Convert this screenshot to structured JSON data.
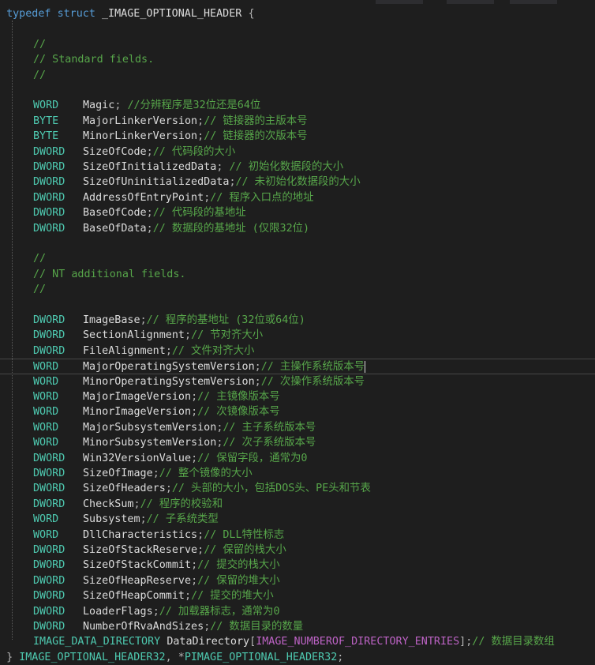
{
  "code": {
    "header_line": {
      "keyword1": "typedef",
      "keyword2": "struct",
      "name": "_IMAGE_OPTIONAL_HEADER",
      "brace": "{"
    },
    "comment_block_1": [
      "//",
      "// Standard fields.",
      "//"
    ],
    "standard_fields": [
      {
        "type": "WORD",
        "name": "Magic",
        "comment": "//分辨程序是32位还是64位",
        "sep": "; "
      },
      {
        "type": "BYTE",
        "name": "MajorLinkerVersion",
        "comment": "// 链接器的主版本号",
        "sep": ";"
      },
      {
        "type": "BYTE",
        "name": "MinorLinkerVersion",
        "comment": "// 链接器的次版本号",
        "sep": ";"
      },
      {
        "type": "DWORD",
        "name": "SizeOfCode",
        "comment": "// 代码段的大小",
        "sep": ";"
      },
      {
        "type": "DWORD",
        "name": "SizeOfInitializedData",
        "comment": "// 初始化数据段的大小",
        "sep": "; "
      },
      {
        "type": "DWORD",
        "name": "SizeOfUninitializedData",
        "comment": "// 未初始化数据段的大小",
        "sep": ";"
      },
      {
        "type": "DWORD",
        "name": "AddressOfEntryPoint",
        "comment": "// 程序入口点的地址",
        "sep": ";"
      },
      {
        "type": "DWORD",
        "name": "BaseOfCode",
        "comment": "// 代码段的基地址",
        "sep": ";"
      },
      {
        "type": "DWORD",
        "name": "BaseOfData",
        "comment": "// 数据段的基地址 (仅限32位)",
        "sep": ";"
      }
    ],
    "comment_block_2": [
      "//",
      "// NT additional fields.",
      "//"
    ],
    "nt_fields": [
      {
        "type": "DWORD",
        "name": "ImageBase",
        "comment": "// 程序的基地址 (32位或64位)",
        "sep": ";"
      },
      {
        "type": "DWORD",
        "name": "SectionAlignment",
        "comment": "// 节对齐大小",
        "sep": ";"
      },
      {
        "type": "DWORD",
        "name": "FileAlignment",
        "comment": "// 文件对齐大小",
        "sep": ";"
      },
      {
        "type": "WORD",
        "name": "MajorOperatingSystemVersion",
        "comment": "// 主操作系统版本号",
        "sep": ";"
      },
      {
        "type": "WORD",
        "name": "MinorOperatingSystemVersion",
        "comment": "// 次操作系统版本号",
        "sep": ";"
      },
      {
        "type": "WORD",
        "name": "MajorImageVersion",
        "comment": "// 主镜像版本号",
        "sep": ";"
      },
      {
        "type": "WORD",
        "name": "MinorImageVersion",
        "comment": "// 次镜像版本号",
        "sep": ";"
      },
      {
        "type": "WORD",
        "name": "MajorSubsystemVersion",
        "comment": "// 主子系统版本号",
        "sep": ";"
      },
      {
        "type": "WORD",
        "name": "MinorSubsystemVersion",
        "comment": "// 次子系统版本号",
        "sep": ";"
      },
      {
        "type": "DWORD",
        "name": "Win32VersionValue",
        "comment": "// 保留字段，通常为0",
        "sep": ";"
      },
      {
        "type": "DWORD",
        "name": "SizeOfImage",
        "comment": "// 整个镜像的大小",
        "sep": ";"
      },
      {
        "type": "DWORD",
        "name": "SizeOfHeaders",
        "comment": "// 头部的大小，包括DOS头、PE头和节表",
        "sep": ";"
      },
      {
        "type": "DWORD",
        "name": "CheckSum",
        "comment": "// 程序的校验和",
        "sep": ";"
      },
      {
        "type": "WORD",
        "name": "Subsystem",
        "comment": "// 子系统类型",
        "sep": ";"
      },
      {
        "type": "WORD",
        "name": "DllCharacteristics",
        "comment": "// DLL特性标志",
        "sep": ";"
      },
      {
        "type": "DWORD",
        "name": "SizeOfStackReserve",
        "comment": "// 保留的栈大小",
        "sep": ";"
      },
      {
        "type": "DWORD",
        "name": "SizeOfStackCommit",
        "comment": "// 提交的栈大小",
        "sep": ";"
      },
      {
        "type": "DWORD",
        "name": "SizeOfHeapReserve",
        "comment": "// 保留的堆大小",
        "sep": ";"
      },
      {
        "type": "DWORD",
        "name": "SizeOfHeapCommit",
        "comment": "// 提交的堆大小",
        "sep": ";"
      },
      {
        "type": "DWORD",
        "name": "LoaderFlags",
        "comment": "// 加载器标志，通常为0",
        "sep": ";"
      },
      {
        "type": "DWORD",
        "name": "NumberOfRvaAndSizes",
        "comment": "// 数据目录的数量",
        "sep": ";"
      }
    ],
    "data_directory_line": {
      "type": "IMAGE_DATA_DIRECTORY",
      "name": "DataDirectory",
      "open": "[",
      "macro": "IMAGE_NUMBEROF_DIRECTORY_ENTRIES",
      "close": "];",
      "comment": "// 数据目录数组"
    },
    "footer_line": {
      "brace": "}",
      "name1": "IMAGE_OPTIONAL_HEADER32",
      "sep": ", *",
      "name2": "PIMAGE_OPTIONAL_HEADER32",
      "end": ";"
    }
  },
  "colors": {
    "background": "#1e1e1e",
    "keyword": "#569cd6",
    "type": "#4ec9b0",
    "comment": "#57a64a",
    "macro": "#bd63c5",
    "identifier": "#dcdcdc"
  }
}
